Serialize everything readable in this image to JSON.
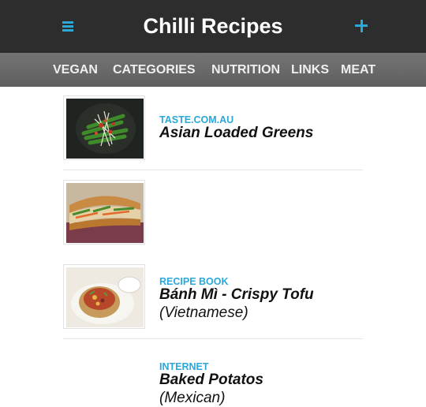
{
  "header": {
    "title": "Chilli Recipes",
    "menu_icon": "hamburger-menu-icon",
    "add_icon": "plus-icon",
    "accent_color": "#2aa8d8",
    "background_color": "#2d2d2d"
  },
  "nav": {
    "items": [
      "VEGAN",
      "CATEGORIES",
      "NUTRITION",
      "LINKS",
      "MEAT"
    ]
  },
  "recipes": [
    {
      "source": "TASTE.COM.AU",
      "title": "Asian Loaded Greens",
      "subtitle": ""
    },
    {
      "source": "RECIPE BOOK",
      "title": "Bánh Mì - Crispy Tofu",
      "subtitle": "(Vietnamese)"
    },
    {
      "source": "INTERNET",
      "title": "Baked Potatos",
      "subtitle": "(Mexican)"
    }
  ]
}
